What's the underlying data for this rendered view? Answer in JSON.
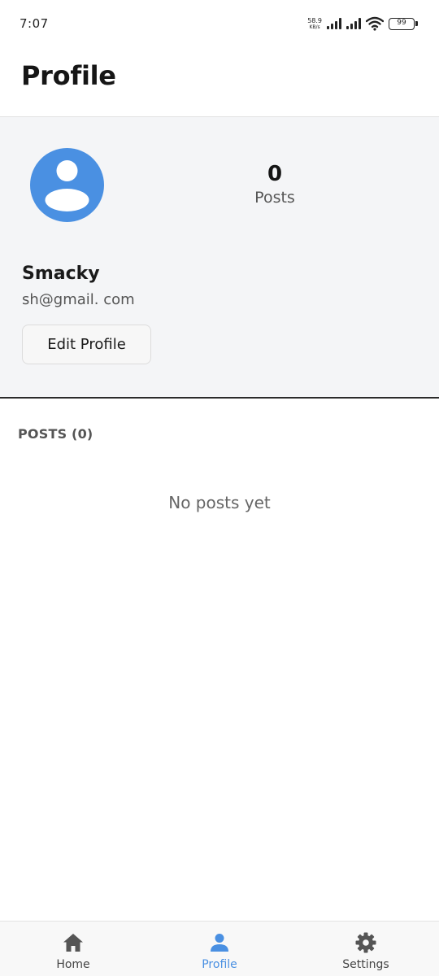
{
  "status_bar": {
    "time": "7:07",
    "net_speed_value": "58.9",
    "net_speed_unit": "KB/s",
    "battery_level": "99",
    "icons": [
      "signal-icon",
      "signal-icon",
      "wifi-icon",
      "battery-icon"
    ]
  },
  "header": {
    "title": "Profile"
  },
  "profile": {
    "avatar_icon": "user-avatar-icon",
    "avatar_color": "#4a90e2",
    "posts_count": "0",
    "posts_label": "Posts",
    "name": "Smacky",
    "email": "sh@gmail. com",
    "edit_button_label": "Edit Profile"
  },
  "posts": {
    "heading": "POSTS (0)",
    "empty_message": "No posts yet"
  },
  "bottom_nav": {
    "accent_color": "#4a90e2",
    "items": [
      {
        "label": "Home",
        "icon": "home-icon",
        "active": false
      },
      {
        "label": "Profile",
        "icon": "person-icon",
        "active": true
      },
      {
        "label": "Settings",
        "icon": "gear-icon",
        "active": false
      }
    ]
  }
}
